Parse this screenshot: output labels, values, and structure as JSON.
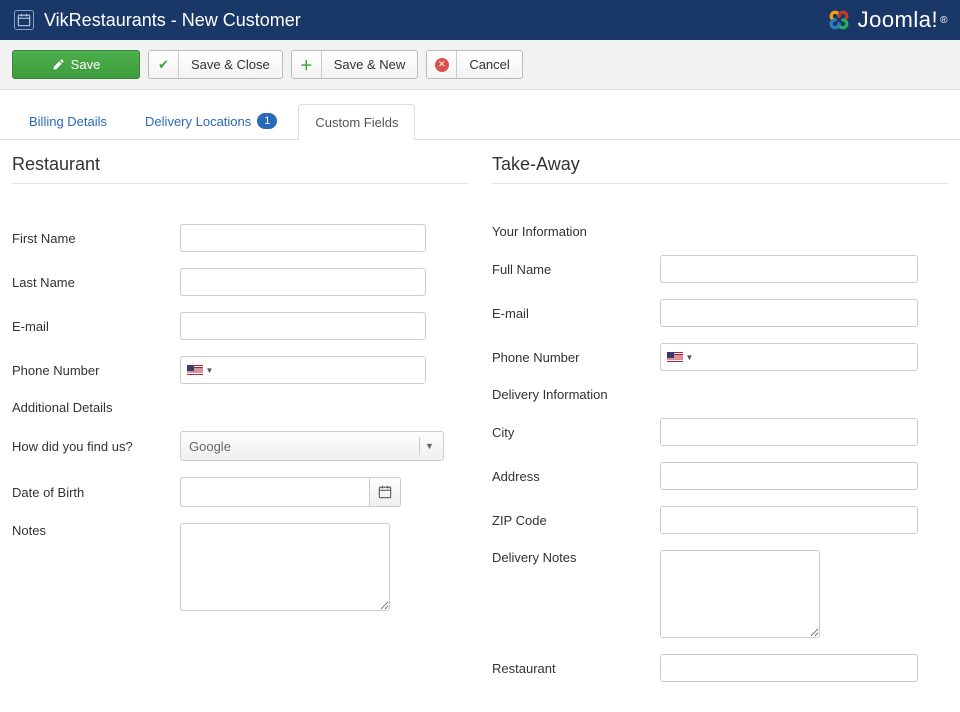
{
  "header": {
    "page_title": "VikRestaurants - New Customer",
    "brand": "Joomla!"
  },
  "toolbar": {
    "save": "Save",
    "save_close": "Save & Close",
    "save_new": "Save & New",
    "cancel": "Cancel"
  },
  "tabs": {
    "billing": "Billing Details",
    "delivery": "Delivery Locations",
    "delivery_badge": "1",
    "custom": "Custom Fields"
  },
  "restaurant": {
    "title": "Restaurant",
    "first_name": "First Name",
    "last_name": "Last Name",
    "email": "E-mail",
    "phone": "Phone Number",
    "additional": "Additional Details",
    "how_find": "How did you find us?",
    "how_find_value": "Google",
    "dob": "Date of Birth",
    "notes": "Notes"
  },
  "takeaway": {
    "title": "Take-Away",
    "your_info": "Your Information",
    "full_name": "Full Name",
    "email": "E-mail",
    "phone": "Phone Number",
    "delivery_info": "Delivery Information",
    "city": "City",
    "address": "Address",
    "zip": "ZIP Code",
    "delivery_notes": "Delivery Notes",
    "restaurant": "Restaurant"
  }
}
